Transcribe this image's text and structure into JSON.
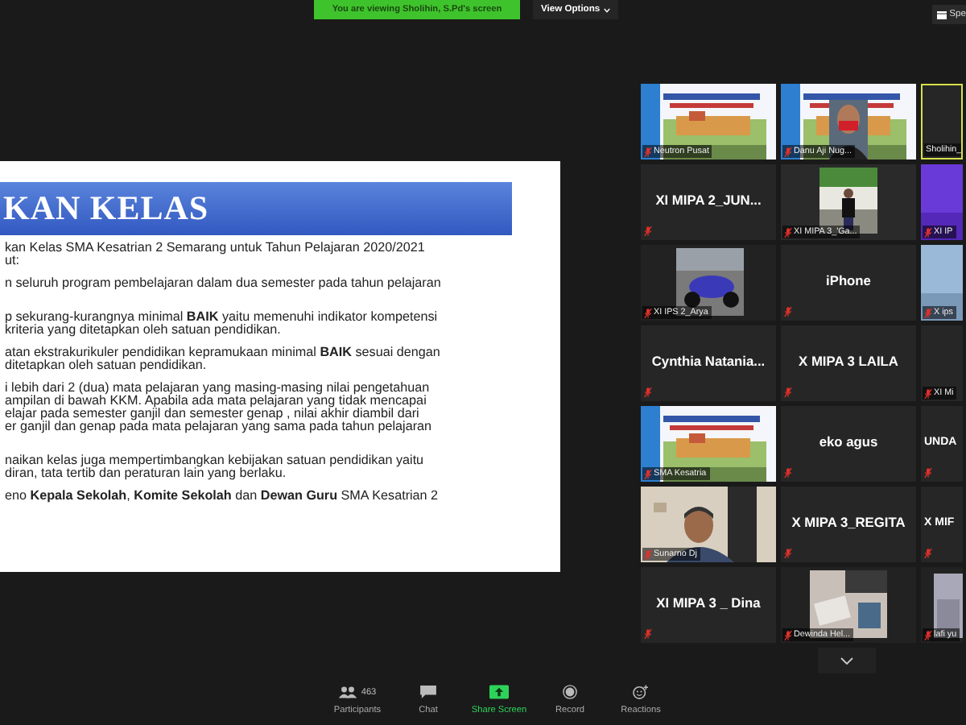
{
  "top_bar": {
    "viewing_banner": "You are viewing Sholihin, S.Pd's screen",
    "view_options": "View Options",
    "speaker_view": "Spe"
  },
  "slide": {
    "title": "KAN KELAS",
    "paragraphs": [
      [
        "kan Kelas SMA Kesatrian 2 Semarang untuk Tahun Pelajaran 2020/2021",
        "ut:"
      ],
      [
        "n seluruh program pembelajaran dalam dua semester pada tahun pelajaran"
      ],
      [
        "p sekurang-kurangnya minimal **BAIK** yaitu memenuhi indikator kompetensi",
        "kriteria yang ditetapkan oleh satuan pendidikan."
      ],
      [
        "atan ekstrakurikuler pendidikan kepramukaan minimal **BAIK** sesuai dengan",
        "ditetapkan oleh satuan pendidikan."
      ],
      [
        "i lebih dari 2 (dua) mata pelajaran yang masing-masing nilai pengetahuan",
        "ampilan di bawah KKM. Apabila ada mata pelajaran yang tidak mencapai",
        "elajar pada semester ganjil dan semester genap , nilai akhir diambil dari",
        "er ganjil dan genap pada mata pelajaran yang sama pada tahun pelajaran"
      ],
      [
        "naikan kelas juga mempertimbangkan kebijakan satuan pendidikan yaitu",
        "diran, tata tertib dan peraturan lain yang berlaku."
      ],
      [
        "eno **Kepala Sekolah**, **Komite Sekolah** dan **Dewan Guru** SMA Kesatrian 2"
      ]
    ]
  },
  "gallery": {
    "tiles": [
      {
        "kind": "video",
        "name": "Neutron Pusat",
        "muted": true,
        "speaking": false
      },
      {
        "kind": "video",
        "name": "Danu Aji Nug...",
        "muted": true,
        "speaking": false
      },
      {
        "kind": "blank",
        "name": "Sholihin_",
        "muted": false,
        "speaking": true
      },
      {
        "kind": "name",
        "name": "XI MIPA 2_JUN...",
        "muted": true,
        "speaking": false
      },
      {
        "kind": "video",
        "name": "XI MIPA 3_'Ga...",
        "muted": true,
        "speaking": false
      },
      {
        "kind": "video",
        "name": "XI IP",
        "muted": true,
        "speaking": false
      },
      {
        "kind": "video",
        "name": "XI IPS 2_Arya",
        "muted": true,
        "speaking": false
      },
      {
        "kind": "name",
        "name": "iPhone",
        "muted": true,
        "speaking": false
      },
      {
        "kind": "video",
        "name": "X ips",
        "muted": true,
        "speaking": false
      },
      {
        "kind": "name",
        "name": "Cynthia Natania...",
        "muted": true,
        "speaking": false
      },
      {
        "kind": "name",
        "name": "X MIPA 3 LAILA",
        "muted": true,
        "speaking": false
      },
      {
        "kind": "blank",
        "name": "XI Mi",
        "muted": true,
        "speaking": false
      },
      {
        "kind": "video",
        "name": "SMA Kesatria",
        "muted": true,
        "speaking": false
      },
      {
        "kind": "name",
        "name": "eko agus",
        "muted": true,
        "speaking": false
      },
      {
        "kind": "name",
        "name": "UNDA",
        "muted": true,
        "speaking": false
      },
      {
        "kind": "video",
        "name": "Sunarno Dj",
        "muted": true,
        "speaking": false
      },
      {
        "kind": "name",
        "name": "X MIPA 3_REGITA",
        "muted": true,
        "speaking": false
      },
      {
        "kind": "name",
        "name": "X MIF",
        "muted": true,
        "speaking": false
      },
      {
        "kind": "name",
        "name": "XI MIPA 3 _ Dina",
        "muted": true,
        "speaking": false
      },
      {
        "kind": "video",
        "name": "Dewinda Hel...",
        "muted": true,
        "speaking": false
      },
      {
        "kind": "video",
        "name": "lafi yu",
        "muted": true,
        "speaking": false
      }
    ]
  },
  "toolbar": [
    {
      "kind": "participants",
      "label": "Participants",
      "count": "463"
    },
    {
      "kind": "chat",
      "label": "Chat"
    },
    {
      "kind": "share",
      "label": "Share Screen"
    },
    {
      "kind": "record",
      "label": "Record"
    },
    {
      "kind": "reactions",
      "label": "Reactions"
    }
  ]
}
